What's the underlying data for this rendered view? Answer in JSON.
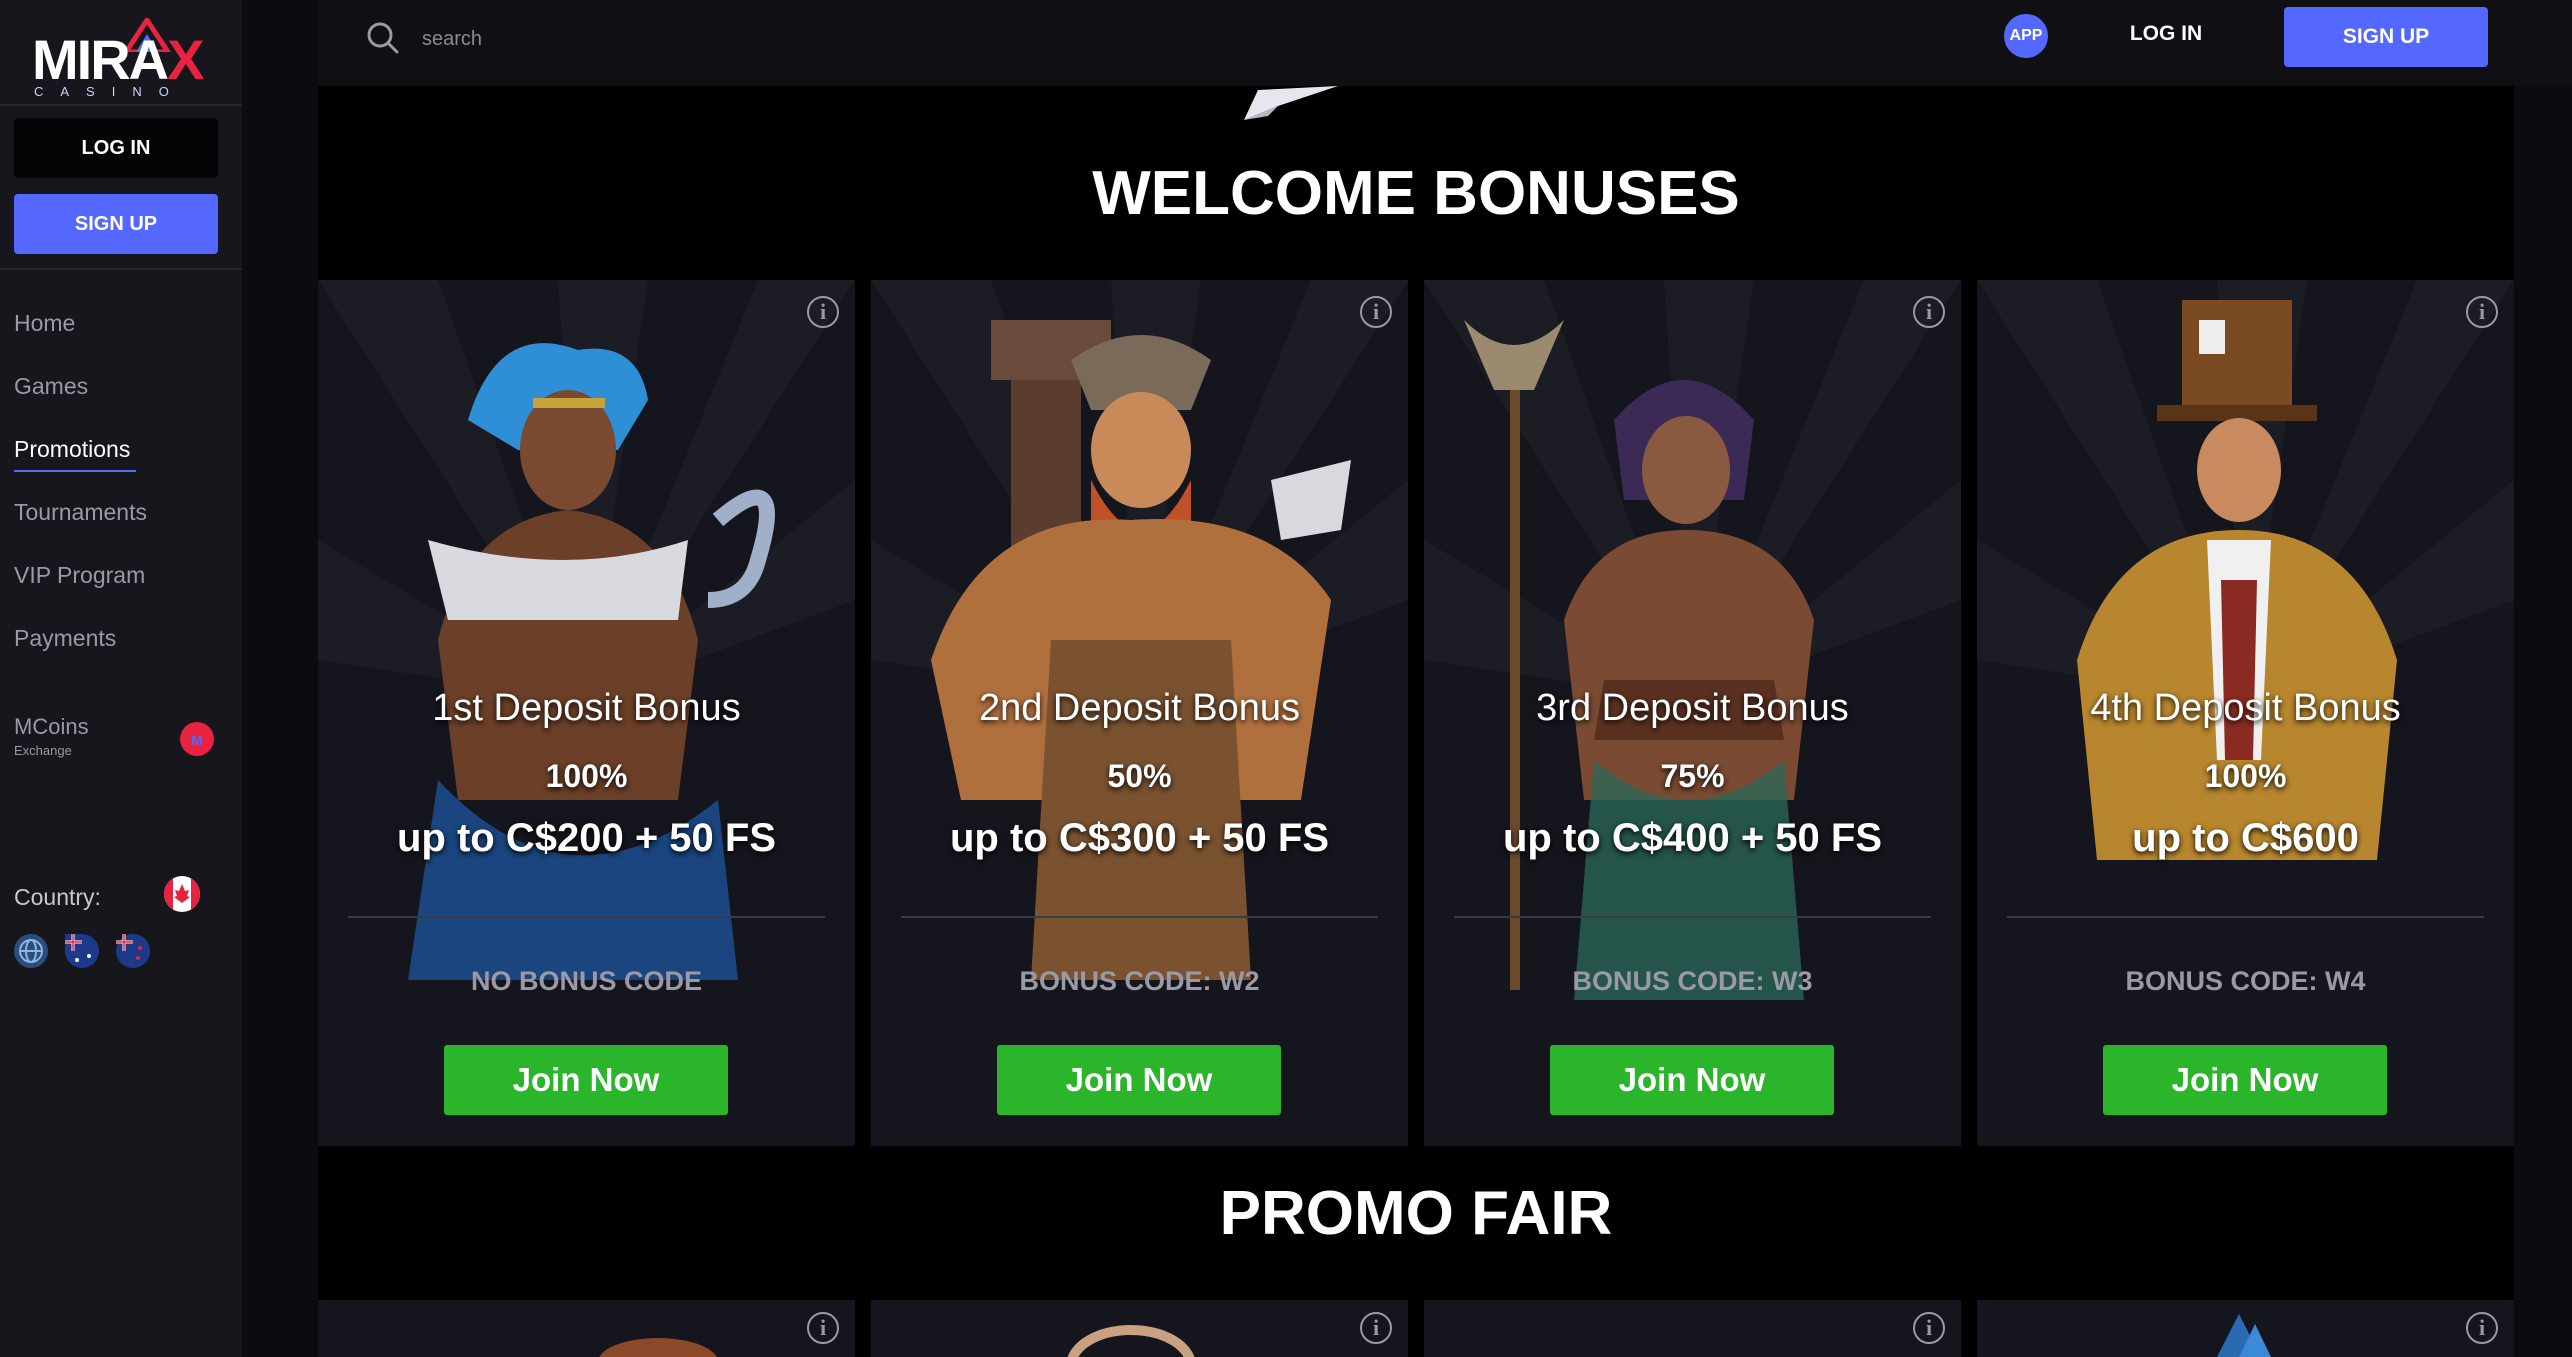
{
  "brand": {
    "logo_word_left": "MIRA",
    "logo_word_x": "X",
    "logo_sub": "CASINO"
  },
  "sidebar": {
    "login_label": "LOG IN",
    "signup_label": "SIGN UP",
    "nav": [
      {
        "label": "Home"
      },
      {
        "label": "Games"
      },
      {
        "label": "Promotions",
        "active": true
      },
      {
        "label": "Tournaments"
      },
      {
        "label": "VIP Program"
      },
      {
        "label": "Payments"
      }
    ],
    "mcoins_label": "MCoins",
    "mcoins_sub": "Exchange",
    "country_label": "Country:",
    "flag_icons": [
      "canada-flag-icon",
      "globe-icon",
      "australia-flag-icon",
      "new-zealand-flag-icon"
    ]
  },
  "header": {
    "search_placeholder": "search",
    "app_label": "APP",
    "login_label": "LOG IN",
    "signup_label": "SIGN UP"
  },
  "main": {
    "welcome_title": "WELCOME BONUSES",
    "promo_title": "PROMO FAIR",
    "cards": [
      {
        "title": "1st Deposit Bonus",
        "percent": "100%",
        "amount": "up to C$200 + 50 FS",
        "code": "NO BONUS CODE",
        "join_label": "Join Now"
      },
      {
        "title": "2nd Deposit Bonus",
        "percent": "50%",
        "amount": "up to C$300 + 50 FS",
        "code": "BONUS CODE: W2",
        "join_label": "Join Now"
      },
      {
        "title": "3rd Deposit Bonus",
        "percent": "75%",
        "amount": "up to C$400 + 50 FS",
        "code": "BONUS CODE: W3",
        "join_label": "Join Now"
      },
      {
        "title": "4th Deposit Bonus",
        "percent": "100%",
        "amount": "up to C$600",
        "code": "BONUS CODE: W4",
        "join_label": "Join Now"
      }
    ],
    "info_glyph": "i"
  },
  "colors": {
    "accent": "#5468ff",
    "join_green": "#2bb52b",
    "brand_red": "#e8233f",
    "sidebar_bg": "#16161c",
    "card_bg": "#15151d"
  }
}
